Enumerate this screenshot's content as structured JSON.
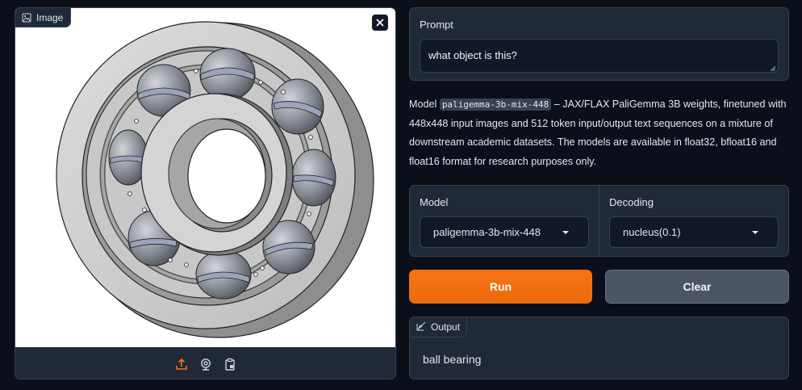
{
  "image_panel": {
    "label": "Image",
    "label_icon": "image-icon",
    "close_icon": "close-icon",
    "toolbar_icons": [
      "upload-icon",
      "webcam-icon",
      "clipboard-icon"
    ],
    "accent": "#f97316"
  },
  "prompt": {
    "label": "Prompt",
    "value": "what object is this?"
  },
  "description": {
    "prefix": "Model ",
    "model_code": "paligemma-3b-mix-448",
    "body": " – JAX/FLAX PaliGemma 3B weights, finetuned with 448x448 input images and 512 token input/output text sequences on a mixture of downstream academic datasets. The models are available in float32, bfloat16 and float16 format for research purposes only."
  },
  "settings": {
    "model": {
      "label": "Model",
      "selected": "paligemma-3b-mix-448"
    },
    "decoding": {
      "label": "Decoding",
      "selected": "nucleus(0.1)"
    }
  },
  "buttons": {
    "run": "Run",
    "clear": "Clear"
  },
  "output": {
    "label": "Output",
    "label_icon": "chart-icon",
    "text": "ball bearing"
  },
  "colors": {
    "background": "#0b0f19",
    "panel": "#1f2937",
    "border": "#374151",
    "run_button": "#f97316",
    "clear_button": "#4b5563"
  }
}
